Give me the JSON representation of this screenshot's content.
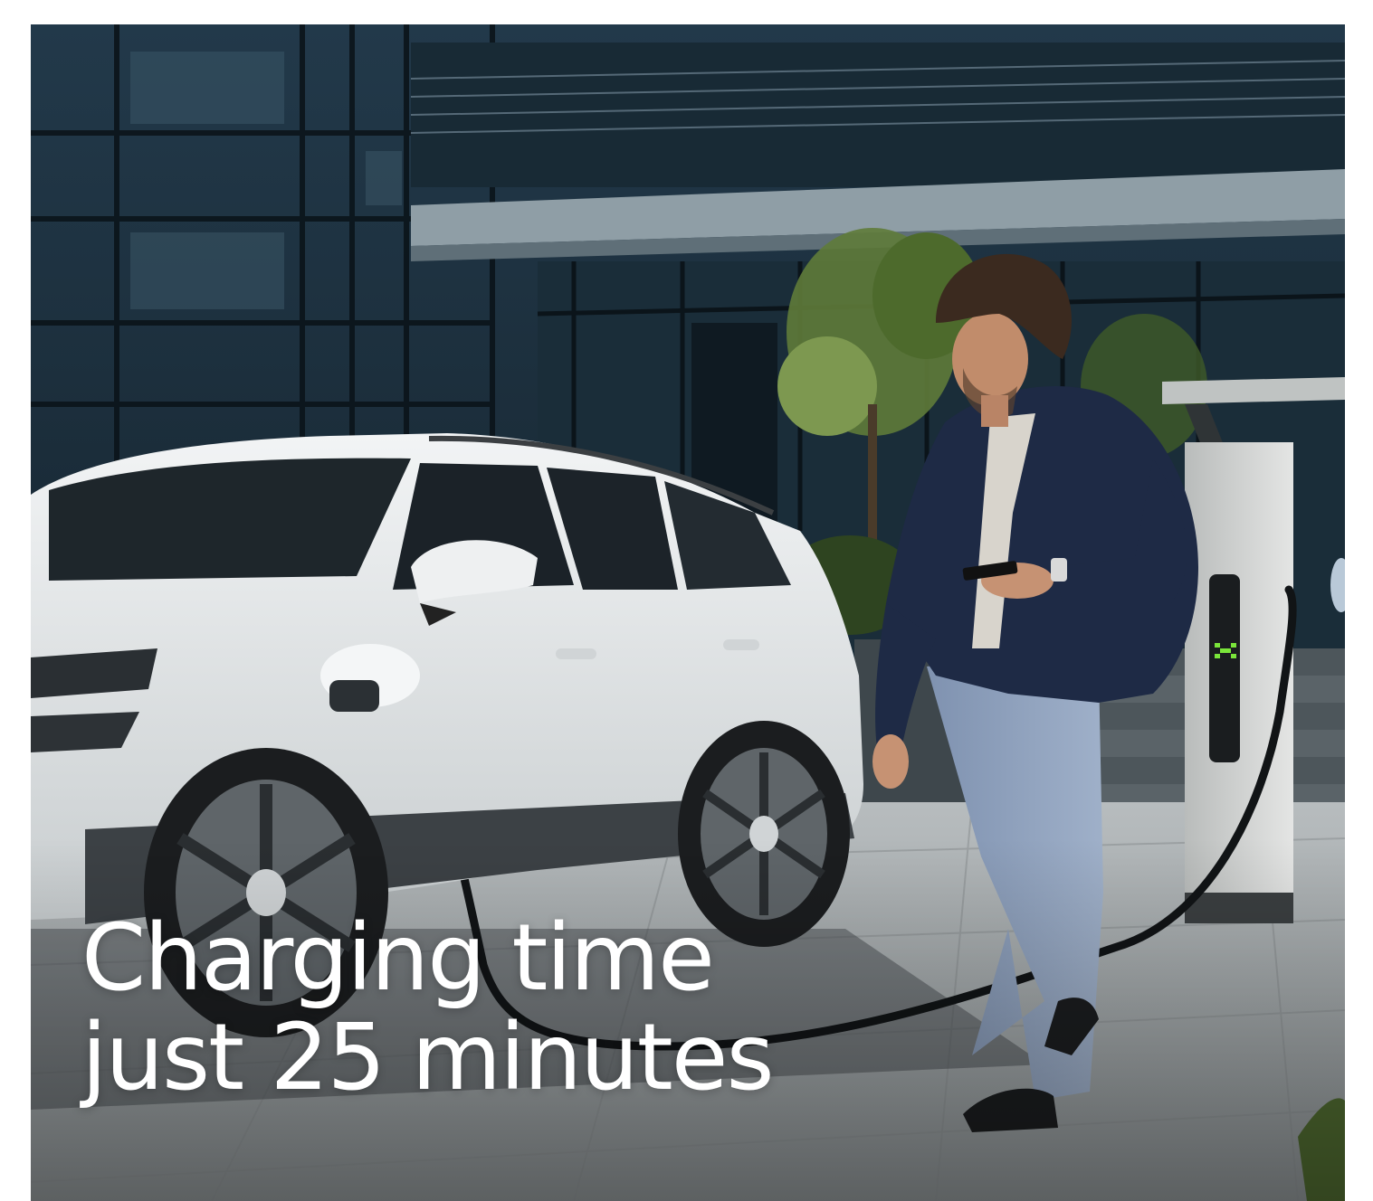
{
  "hero": {
    "headline_line1": "Charging time",
    "headline_line2": "just 25 minutes",
    "image_description": "hero-photo"
  },
  "colors": {
    "headline_text": "#ffffff",
    "building_glass": "#1f3440",
    "pavement": "#a9aeb0",
    "car_body": "#e6e9ea",
    "jacket": "#1e2a45",
    "trousers": "#8ea0bd",
    "charger": "#cfd1d0",
    "charger_led": "#7ae53a"
  }
}
